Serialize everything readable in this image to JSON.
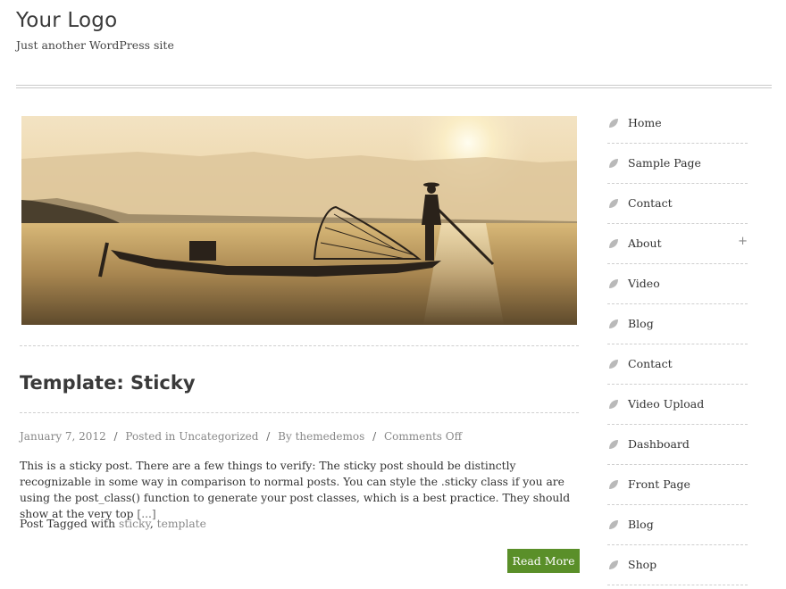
{
  "site": {
    "logo": "Your Logo",
    "tagline": "Just another WordPress site"
  },
  "post": {
    "title": "Template: Sticky",
    "meta": {
      "date": "January 7, 2012",
      "category_prefix": "Posted in",
      "category": "Uncategorized",
      "author_prefix": "By",
      "author": "themedemos",
      "comments": "Comments Off"
    },
    "excerpt_main": "This is a sticky post. There are a few things to verify: The sticky post should be distinctly recognizable in some way in comparison to normal posts. You can style the .sticky class if you are using the post_class() function to generate your post classes, which is a best practice. They should show at the very top",
    "excerpt_more": "[...]",
    "tags_prefix": "Post Tagged with",
    "tags": [
      "sticky",
      "template"
    ],
    "read_more": "Read More"
  },
  "sidebar": {
    "items": [
      {
        "label": "Home"
      },
      {
        "label": "Sample Page"
      },
      {
        "label": "Contact"
      },
      {
        "label": "About",
        "expand": "+"
      },
      {
        "label": "Video"
      },
      {
        "label": "Blog"
      },
      {
        "label": "Contact"
      },
      {
        "label": "Video Upload"
      },
      {
        "label": "Dashboard"
      },
      {
        "label": "Front Page"
      },
      {
        "label": "Blog"
      },
      {
        "label": "Shop"
      }
    ]
  },
  "colors": {
    "accent": "#5a8f29",
    "leaf_icon": "#b9b9b9"
  },
  "icons": {
    "menu_bullet": "leaf-icon"
  }
}
